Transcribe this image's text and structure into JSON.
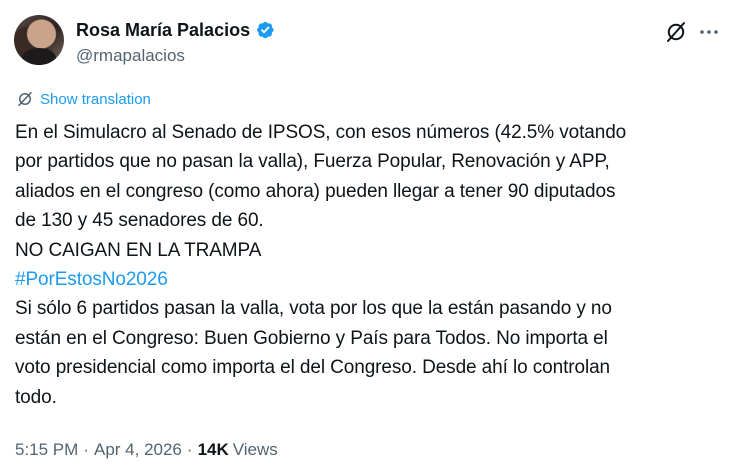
{
  "author": {
    "display_name": "Rosa María Palacios",
    "handle": "@rmapalacios",
    "verified": true
  },
  "actions": {
    "grok_icon": "grok-icon",
    "more_icon": "more-horizontal-icon"
  },
  "translation": {
    "label": "Show translation"
  },
  "body": {
    "line1": "En el Simulacro al Senado de IPSOS, con esos números (42.5% votando",
    "line2": "por partidos que no pasan la valla), Fuerza Popular, Renovación y APP,",
    "line3": "aliados en el congreso (como ahora) pueden llegar a tener 90 diputados",
    "line4": "de 130 y 45 senadores de 60.",
    "line5": "NO CAIGAN EN LA TRAMPA",
    "hashtag": "#PorEstosNo2026",
    "line7": "Si sólo 6 partidos pasan la valla, vota por los que la están pasando y no",
    "line8": "están en el Congreso: Buen Gobierno y País para Todos. No importa el",
    "line9": "voto presidencial como importa el del Congreso. Desde ahí lo controlan",
    "line10": "todo."
  },
  "meta": {
    "time": "5:15 PM",
    "separator": "·",
    "date": "Apr 4, 2026",
    "views_count": "14K",
    "views_label": "Views"
  },
  "colors": {
    "accent": "#1d9bf0",
    "text_primary": "#0f1419",
    "text_secondary": "#536471"
  }
}
